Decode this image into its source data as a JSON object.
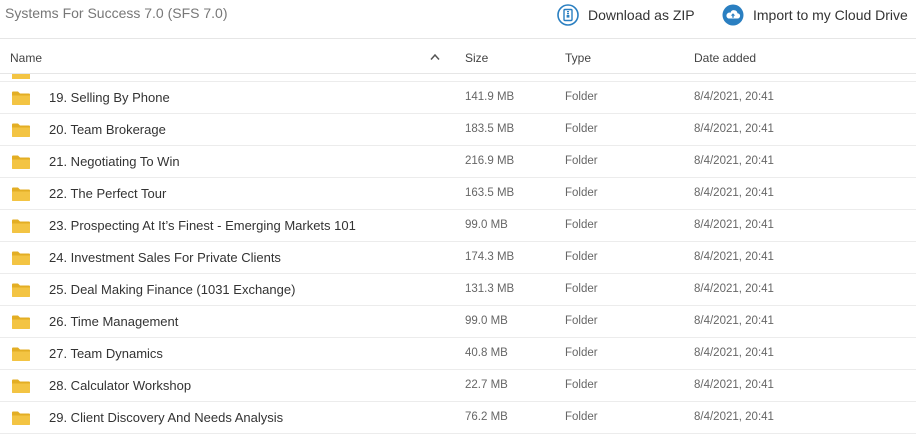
{
  "folder": {
    "title": "Systems For Success 7.0 (SFS 7.0)"
  },
  "actions": {
    "download_zip": "Download as ZIP",
    "import_cloud": "Import to my Cloud Drive"
  },
  "columns": {
    "name": "Name",
    "size": "Size",
    "type": "Type",
    "date": "Date added"
  },
  "colors": {
    "accent": "#2a7fc1",
    "folder": "#f3c443",
    "folder_dark": "#e3ae24"
  },
  "rows": [
    {
      "name": "19. Selling By Phone",
      "size": "141.9 MB",
      "type": "Folder",
      "date": "8/4/2021, 20:41"
    },
    {
      "name": "20. Team Brokerage",
      "size": "183.5 MB",
      "type": "Folder",
      "date": "8/4/2021, 20:41"
    },
    {
      "name": "21. Negotiating To Win",
      "size": "216.9 MB",
      "type": "Folder",
      "date": "8/4/2021, 20:41"
    },
    {
      "name": "22. The Perfect Tour",
      "size": "163.5 MB",
      "type": "Folder",
      "date": "8/4/2021, 20:41"
    },
    {
      "name": "23. Prospecting At It’s Finest - Emerging Markets 101",
      "size": "99.0 MB",
      "type": "Folder",
      "date": "8/4/2021, 20:41"
    },
    {
      "name": "24. Investment Sales For Private Clients",
      "size": "174.3 MB",
      "type": "Folder",
      "date": "8/4/2021, 20:41"
    },
    {
      "name": "25. Deal Making Finance (1031 Exchange)",
      "size": "131.3 MB",
      "type": "Folder",
      "date": "8/4/2021, 20:41"
    },
    {
      "name": "26. Time Management",
      "size": "99.0 MB",
      "type": "Folder",
      "date": "8/4/2021, 20:41"
    },
    {
      "name": "27. Team Dynamics",
      "size": "40.8 MB",
      "type": "Folder",
      "date": "8/4/2021, 20:41"
    },
    {
      "name": "28. Calculator Workshop",
      "size": "22.7 MB",
      "type": "Folder",
      "date": "8/4/2021, 20:41"
    },
    {
      "name": "29. Client Discovery And Needs Analysis",
      "size": "76.2 MB",
      "type": "Folder",
      "date": "8/4/2021, 20:41"
    }
  ]
}
